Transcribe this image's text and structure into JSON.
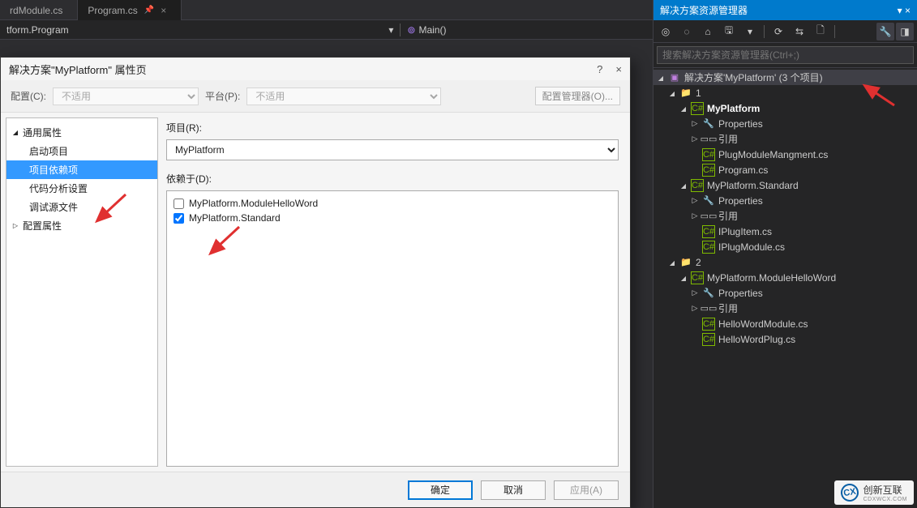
{
  "bg": {
    "tab1": "rdModule.cs",
    "tab2": "Program.cs",
    "breadcrumb_left": "tform.Program",
    "breadcrumb_right": "Main()"
  },
  "panel": {
    "title": "解决方案资源管理器",
    "search_placeholder": "搜索解决方案资源管理器(Ctrl+;)",
    "solution_label": "解决方案'MyPlatform' (3 个项目)",
    "folder1": "1",
    "proj1": "MyPlatform",
    "p1_props": "Properties",
    "p1_refs": "引用",
    "p1_f1": "PlugModuleMangment.cs",
    "p1_f2": "Program.cs",
    "proj2": "MyPlatform.Standard",
    "p2_props": "Properties",
    "p2_refs": "引用",
    "p2_f1": "IPlugItem.cs",
    "p2_f2": "IPlugModule.cs",
    "folder2": "2",
    "proj3": "MyPlatform.ModuleHelloWord",
    "p3_props": "Properties",
    "p3_refs": "引用",
    "p3_f1": "HelloWordModule.cs",
    "p3_f2": "HelloWordPlug.cs"
  },
  "dialog": {
    "title": "解决方案\"MyPlatform\" 属性页",
    "cfg_lbl": "配置(C):",
    "cfg_val": "不适用",
    "plat_lbl": "平台(P):",
    "plat_val": "不适用",
    "cfg_mgr": "配置管理器(O)...",
    "tree": {
      "common": "通用属性",
      "startup": "启动项目",
      "deps": "项目依赖项",
      "analysis": "代码分析设置",
      "debug": "调试源文件",
      "cfgprop": "配置属性"
    },
    "proj_lbl": "项目(R):",
    "proj_sel": "MyPlatform",
    "dep_lbl": "依赖于(D):",
    "dep1": "MyPlatform.ModuleHelloWord",
    "dep2": "MyPlatform.Standard",
    "ok": "确定",
    "cancel": "取消",
    "apply": "应用(A)"
  },
  "watermark": {
    "brand": "创新互联",
    "sub": "CDXWCX.COM"
  }
}
